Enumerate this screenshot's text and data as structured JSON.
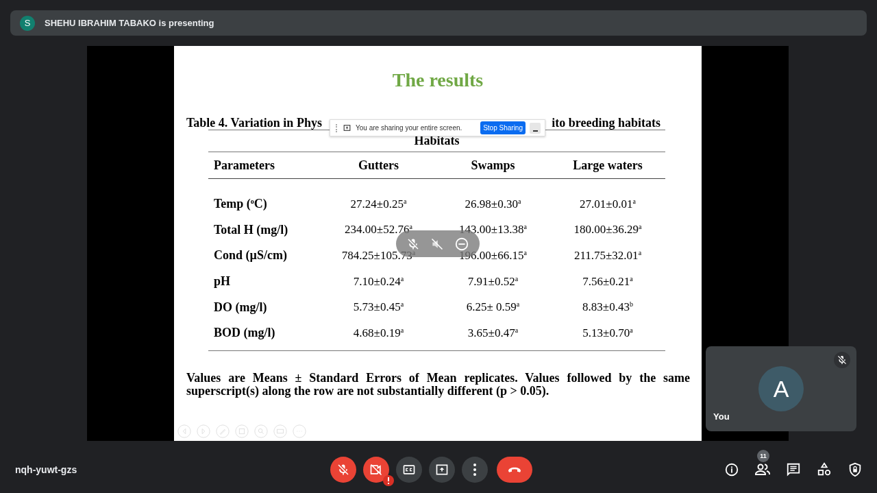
{
  "presenter_banner": {
    "avatar_letter": "S",
    "text": "SHEHU IBRAHIM TABAKO is presenting"
  },
  "slide": {
    "title": "The results",
    "caption_start": "Table 4. Variation in Phys",
    "caption_end": "ito breeding habitats",
    "group_heading": "Habitats",
    "columns": [
      "Parameters",
      "Gutters",
      "Swamps",
      "Large waters"
    ],
    "rows": [
      {
        "parameter": "Temp ($^{o}$C)",
        "values": [
          "27.24±0.25$^{a}$",
          "26.98±0.30$^{a}$",
          "27.01±0.01$^{a}$"
        ]
      },
      {
        "parameter": "Total H (mg/l)",
        "values": [
          "234.00±52.76$^{a}$",
          "143.00±13.38$^{a}$",
          "180.00±36.29$^{a}$"
        ]
      },
      {
        "parameter": "Cond (µS/cm)",
        "values": [
          "784.25±105.73$^{a}$",
          "196.00±66.15$^{a}$",
          "211.75±32.01$^{a}$"
        ]
      },
      {
        "parameter": "pH",
        "values": [
          "7.10±0.24$^{a}$",
          "7.91±0.52$^{a}$",
          "7.56±0.21$^{a}$"
        ]
      },
      {
        "parameter": "DO (mg/l)",
        "values": [
          "5.73±0.45$^{a}$",
          "6.25± 0.59$^{a}$",
          "8.83±0.43$^{b}$"
        ]
      },
      {
        "parameter": "BOD (mg/l)",
        "values": [
          "4.68±0.19$^{a}$",
          "3.65±0.47$^{a}$",
          "5.13±0.70$^{a}$"
        ]
      }
    ],
    "footnote": "Values are Means ± Standard Errors of Mean replicates. Values followed by the same superscript(s) along the row are not substantially different (p > 0.05)."
  },
  "sharing_notice": {
    "text": "You are sharing your entire screen.",
    "button": "Stop Sharing"
  },
  "self_tile": {
    "avatar_letter": "A",
    "name": "You",
    "muted": true
  },
  "meeting_code": "nqh-yuwt-gzs",
  "controls": [
    {
      "kind": "mic",
      "on": false
    },
    {
      "kind": "camera",
      "on": false,
      "alert": true
    },
    {
      "kind": "captions",
      "on": false
    },
    {
      "kind": "present"
    },
    {
      "kind": "more"
    },
    {
      "kind": "leave"
    }
  ],
  "participants_count": "11"
}
